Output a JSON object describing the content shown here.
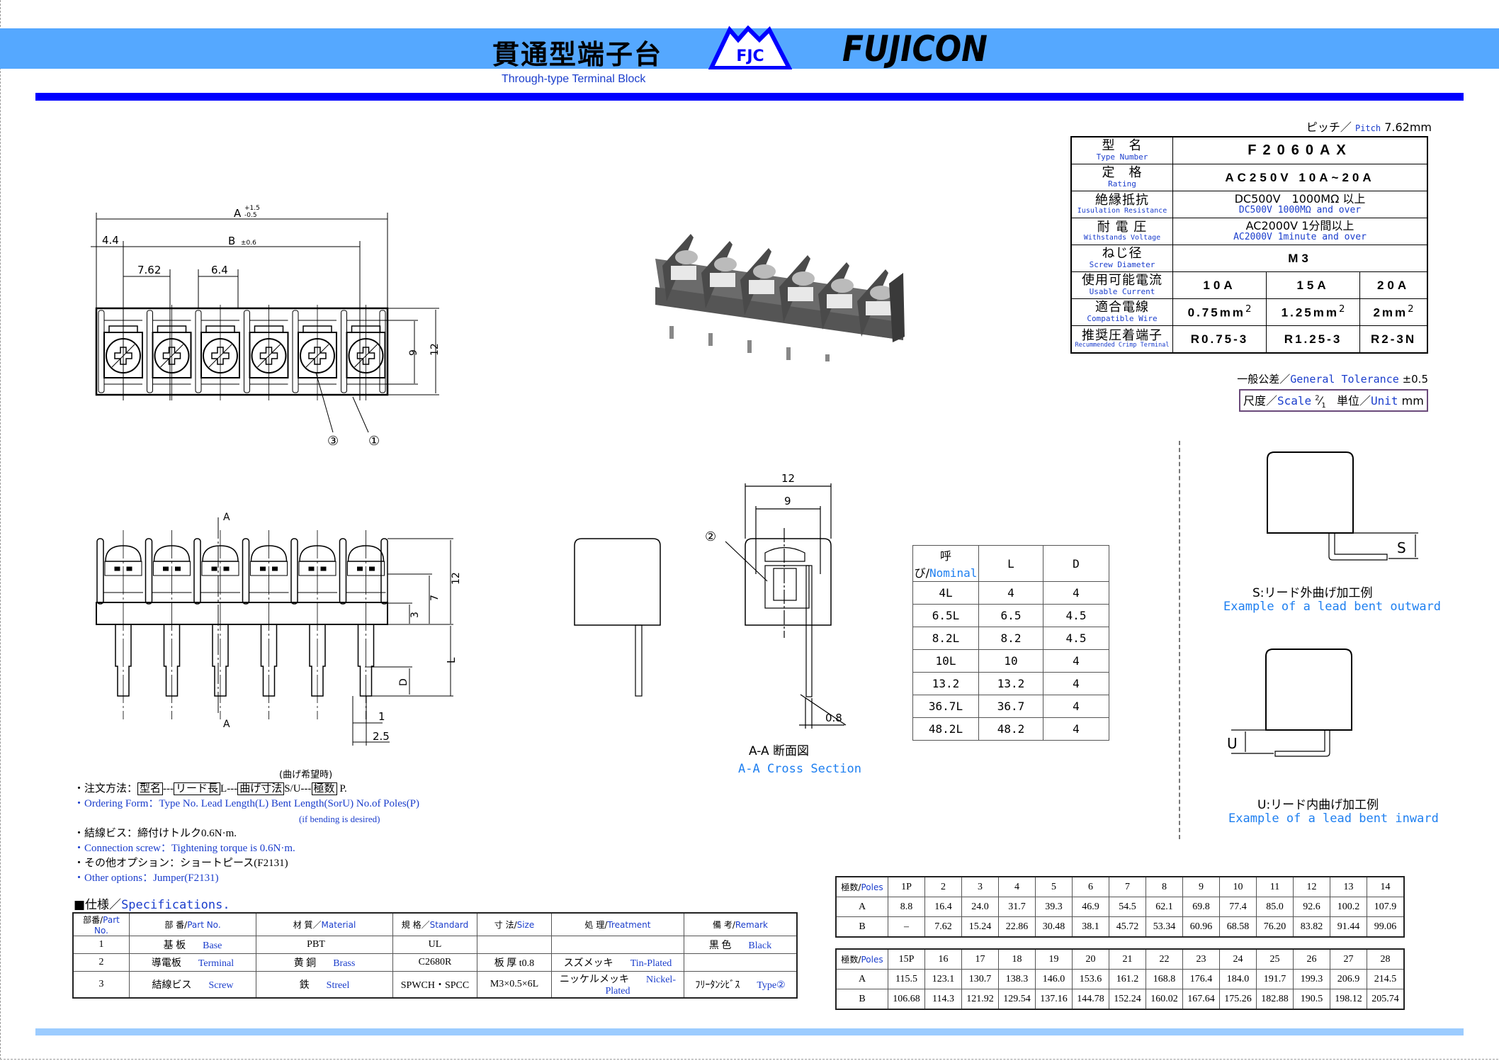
{
  "header": {
    "title_jp": "貫通型端子台",
    "subtitle_en": "Through-type Terminal Block",
    "logo_fjc": "FJC",
    "logo_brand": "FUJICON"
  },
  "pitch": {
    "jp": "ピッチ／",
    "en": "Pitch",
    "value": "7.62mm"
  },
  "spec_table": {
    "type_number": {
      "jp": "型　名",
      "en": "Type Number",
      "value": "F2060AX"
    },
    "rating": {
      "jp": "定　格",
      "en": "Rating",
      "value": "AC250V 10A~20A"
    },
    "insulation": {
      "jp": "絶縁抵抗",
      "en": "Iusulation Resistance",
      "value_jp": "DC500V　1000MΩ 以上",
      "value_en": "DC500V  1000MΩ and over"
    },
    "withstand": {
      "jp": "耐 電 圧",
      "en": "Withstands Voltage",
      "value_jp": "AC2000V 1分間以上",
      "value_en": "AC2000V 1minute and over"
    },
    "screw": {
      "jp": "ねじ径",
      "en": "Screw Diameter",
      "value": "M3"
    },
    "current": {
      "jp": "使用可能電流",
      "en": "Usable Current",
      "values": [
        "10A",
        "15A",
        "20A"
      ]
    },
    "wire": {
      "jp": "適合電線",
      "en": "Compatible Wire",
      "values": [
        "0.75mm",
        "1.25mm",
        "2mm"
      ],
      "sup": "2"
    },
    "crimp": {
      "jp": "推奨圧着端子",
      "en": "Recummended Crimp Terminal",
      "values": [
        "R0.75-3",
        "R1.25-3",
        "R2-3N"
      ]
    }
  },
  "tolerance": {
    "jp": "一般公差／",
    "en": "General Tolerance",
    "value": "±0.5"
  },
  "scale": {
    "jp": "尺度／",
    "en": "Scale",
    "num": "2",
    "den": "1",
    "unit_jp": "単位／",
    "unit_en": "Unit",
    "unit": "mm"
  },
  "drawings": {
    "top_view": {
      "A": "A",
      "A_tol_plus": "+1.5",
      "A_tol_minus": "-0.5",
      "B": "B",
      "B_tol": "±0.6",
      "d1": "4.4",
      "d2": "7.62",
      "d3": "6.4",
      "h1": "9",
      "h2": "12",
      "ref3": "③",
      "ref1": "①"
    },
    "front_view": {
      "section": "A",
      "h12": "12",
      "h7": "7",
      "h3": "3",
      "L": "L",
      "D": "D",
      "w1": "1",
      "w25": "2.5"
    },
    "section_view": {
      "w12": "12",
      "w9": "9",
      "ref2": "②",
      "t08": "0.8",
      "title_jp": "A-A 断面図",
      "title_en": "A-A Cross Section"
    },
    "bend_s": {
      "label": "S",
      "title_jp": "S:リード外曲げ加工例",
      "title_en": "Example of a lead bent outward"
    },
    "bend_u": {
      "label": "U",
      "title_jp": "U:リード内曲げ加工例",
      "title_en": "Example of a lead bent inward"
    }
  },
  "nominal_table": {
    "headers": {
      "jp": "呼び/",
      "en": "Nominal",
      "L": "L",
      "D": "D"
    },
    "rows": [
      [
        "4L",
        "4",
        "4"
      ],
      [
        "6.5L",
        "6.5",
        "4.5"
      ],
      [
        "8.2L",
        "8.2",
        "4.5"
      ],
      [
        "10L",
        "10",
        "4"
      ],
      [
        "13.2",
        "13.2",
        "4"
      ],
      [
        "36.7L",
        "36.7",
        "4"
      ],
      [
        "48.2L",
        "48.2",
        "4"
      ]
    ]
  },
  "poles_tables": [
    {
      "label_jp": "極数/",
      "label_en": "Poles",
      "poles": [
        "1P",
        "2",
        "3",
        "4",
        "5",
        "6",
        "7",
        "8",
        "9",
        "10",
        "11",
        "12",
        "13",
        "14"
      ],
      "A": [
        "8.8",
        "16.4",
        "24.0",
        "31.7",
        "39.3",
        "46.9",
        "54.5",
        "62.1",
        "69.8",
        "77.4",
        "85.0",
        "92.6",
        "100.2",
        "107.9"
      ],
      "B": [
        "–",
        "7.62",
        "15.24",
        "22.86",
        "30.48",
        "38.1",
        "45.72",
        "53.34",
        "60.96",
        "68.58",
        "76.20",
        "83.82",
        "91.44",
        "99.06"
      ]
    },
    {
      "label_jp": "極数/",
      "label_en": "Poles",
      "poles": [
        "15P",
        "16",
        "17",
        "18",
        "19",
        "20",
        "21",
        "22",
        "23",
        "24",
        "25",
        "26",
        "27",
        "28"
      ],
      "A": [
        "115.5",
        "123.1",
        "130.7",
        "138.3",
        "146.0",
        "153.6",
        "161.2",
        "168.8",
        "176.4",
        "184.0",
        "191.7",
        "199.3",
        "206.9",
        "214.5"
      ],
      "B": [
        "106.68",
        "114.3",
        "121.92",
        "129.54",
        "137.16",
        "144.78",
        "152.24",
        "160.02",
        "167.64",
        "175.26",
        "182.88",
        "190.5",
        "198.12",
        "205.74"
      ]
    }
  ],
  "notes": {
    "bend_caption": "(曲げ希望時)",
    "order_jp": {
      "prefix": "・注文方法：",
      "b1": "型名",
      "s1": "---",
      "b2": "リード長",
      "s2": "L---",
      "b3": "曲げ寸法",
      "s3": "S/U---",
      "b4": "極数",
      "s4": " P."
    },
    "order_en": "・Ordering Form：Type No. Lead Length(L) Bent Length(SorU) No.of Poles(P)",
    "order_en_sub": "(if bending is desired)",
    "screw_jp": "・結線ビス：締付けトルク0.6N·m.",
    "screw_en": "・Connection screw：Tightening torque is 0.6N·m.",
    "option_jp": "・その他オプション：ショートピース(F2131)",
    "option_en": "・Other options：Jumper(F2131)"
  },
  "specifications": {
    "title_jp": "■仕様／",
    "title_en": "Specifications.",
    "headers": [
      {
        "jp": "部番/",
        "en": "Part No."
      },
      {
        "jp": "部 番/",
        "en": "Part No."
      },
      {
        "jp": "材 質／",
        "en": "Material"
      },
      {
        "jp": "規 格／",
        "en": "Standard"
      },
      {
        "jp": "寸 法/",
        "en": "Size"
      },
      {
        "jp": "処 理/",
        "en": "Treatment"
      },
      {
        "jp": "備 考/",
        "en": "Remark"
      }
    ],
    "rows": [
      {
        "no": "1",
        "part_jp": "基 板",
        "part_en": "Base",
        "mat_jp": "PBT",
        "mat_en": "",
        "std": "UL",
        "size": "",
        "treat_jp": "",
        "treat_en": "",
        "rem_jp": "黒 色",
        "rem_en": "Black"
      },
      {
        "no": "2",
        "part_jp": "導電板",
        "part_en": "Terminal",
        "mat_jp": "黄 銅",
        "mat_en": "Brass",
        "std": "C2680R",
        "size": "板 厚 t0.8",
        "treat_jp": "スズメッキ",
        "treat_en": "Tin-Plated",
        "rem_jp": "",
        "rem_en": ""
      },
      {
        "no": "3",
        "part_jp": "結線ビス",
        "part_en": "Screw",
        "mat_jp": "鉄",
        "mat_en": "Streel",
        "std": "SPWCH・SPCC",
        "size": "M3×0.5×6L",
        "treat_jp": "ニッケルメッキ",
        "treat_en": "Nickel-Plated",
        "rem_jp": "ﾌﾘｰﾀﾝｼﾋﾞｽ",
        "rem_en": "Type②"
      }
    ]
  },
  "colors": {
    "header_band": "#55a8ff",
    "rule": "#0000ff",
    "footer_rule": "#9cccff",
    "text_blue": "#1a3dcc",
    "caption_blue": "#1e7ff0"
  }
}
